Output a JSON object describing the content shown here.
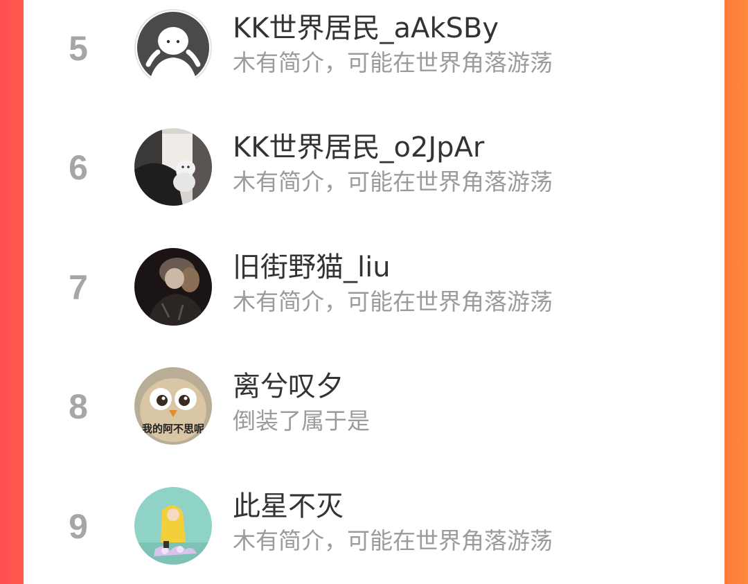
{
  "theme": {
    "left_edge_color": "#ff4f52",
    "right_edge_color": "#ff8a3c",
    "rank_color": "#a6a6a6",
    "name_color": "#333333",
    "bio_color": "#9b9b9b"
  },
  "ranking": [
    {
      "rank": "5",
      "name": "KK世界居民_aAkSBy",
      "bio": "木有简介，可能在世界角落游荡",
      "avatar": "default-user-avatar"
    },
    {
      "rank": "6",
      "name": "KK世界居民_o2JpAr",
      "bio": "木有简介，可能在世界角落游荡",
      "avatar": "photo-avatar-cat"
    },
    {
      "rank": "7",
      "name": "旧街野猫_liu",
      "bio": "木有简介，可能在世界角落游荡",
      "avatar": "anime-avatar-dark"
    },
    {
      "rank": "8",
      "name": "离兮叹夕",
      "bio": "倒装了属于是",
      "avatar": "bird-meme-avatar",
      "avatar_text": "我的阿不思呢"
    },
    {
      "rank": "9",
      "name": "此星不灭",
      "bio": "木有简介，可能在世界角落游荡",
      "avatar": "raincoat-girl-avatar"
    }
  ]
}
